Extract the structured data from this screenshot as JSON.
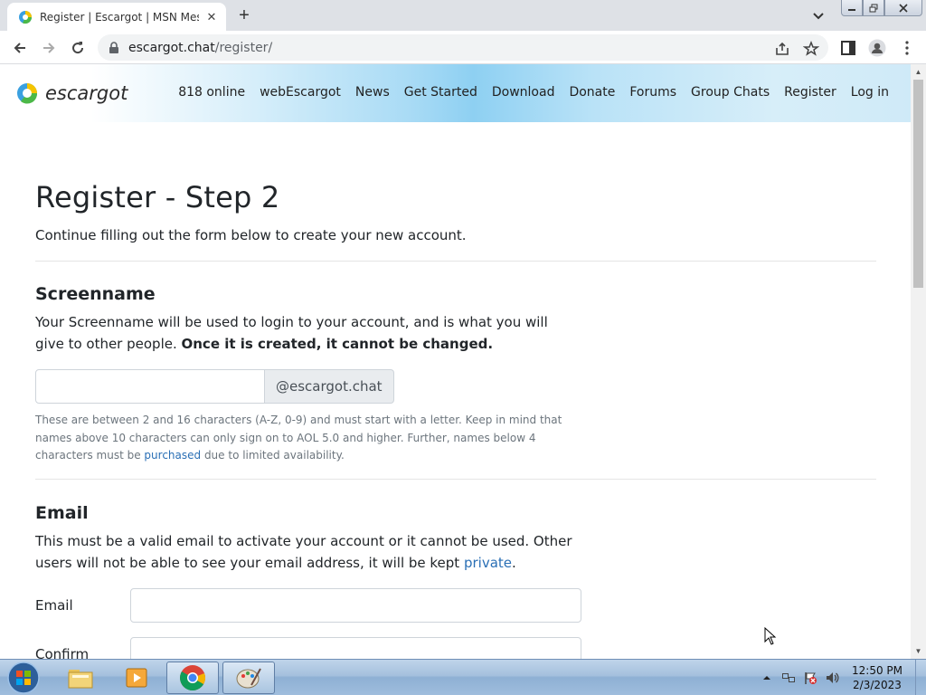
{
  "browser": {
    "tab_title": "Register | Escargot | MSN Messenger",
    "tab_close": "✕",
    "new_tab": "+",
    "url_host": "escargot.chat",
    "url_path": "/register/"
  },
  "site": {
    "logo_text": "escargot",
    "nav": [
      "818 online",
      "webEscargot",
      "News",
      "Get Started",
      "Download",
      "Donate",
      "Forums",
      "Group Chats",
      "Register",
      "Log in"
    ]
  },
  "page": {
    "title": "Register - Step 2",
    "lead": "Continue filling out the form below to create your new account.",
    "screenname": {
      "heading": "Screenname",
      "desc_plain": "Your Screenname will be used to login to your account, and is what you will give to other people. ",
      "desc_bold": "Once it is created, it cannot be changed.",
      "input_value": "",
      "domain_addon": "@escargot.chat",
      "help_part1": "These are between 2 and 16 characters (A-Z, 0-9) and must start with a letter. Keep in mind that names above 10 characters can only sign on to AOL 5.0 and higher. Further, names below 4 characters must be ",
      "help_link": "purchased",
      "help_part2": " due to limited availability."
    },
    "email": {
      "heading": "Email",
      "desc_plain": "This must be a valid email to activate your account or it cannot be used. Other users will not be able to see your email address, it will be kept ",
      "desc_link": "private",
      "desc_end": ".",
      "email_label": "Email",
      "confirm_label": "Confirm",
      "email_value": "",
      "confirm_value": ""
    }
  },
  "taskbar": {
    "time": "12:50 PM",
    "date": "2/3/2023"
  },
  "colors": {
    "link": "#2a6fb5",
    "header_blue": "#8ed0f2"
  }
}
